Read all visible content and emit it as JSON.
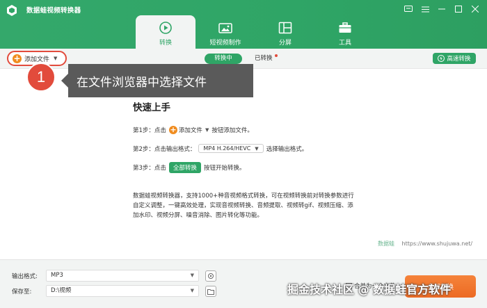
{
  "app": {
    "title": "数据蛙视频转换器"
  },
  "tabs": [
    {
      "label": "转换",
      "icon": "convert-icon",
      "active": true
    },
    {
      "label": "短视频制作",
      "icon": "short-video-icon",
      "active": false
    },
    {
      "label": "分屏",
      "icon": "split-screen-icon",
      "active": false
    },
    {
      "label": "工具",
      "icon": "toolbox-icon",
      "active": false
    }
  ],
  "toolbar": {
    "add_file": "添加文件",
    "converting": "转换中",
    "converted": "已转换",
    "fast_convert": "高速转换"
  },
  "callout": {
    "number": "1",
    "text": "在文件浏览器中选择文件"
  },
  "quickstart": {
    "title": "快速上手",
    "step1_prefix": "第1步：点击",
    "step1_button": "添加文件",
    "step1_suffix": "按钮添加文件。",
    "step2_prefix": "第2步：点击输出格式：",
    "step2_format": "MP4 H.264/HEVC",
    "step2_suffix": "选择输出格式。",
    "step3_prefix": "第3步：点击",
    "step3_button": "全部转换",
    "step3_suffix": "按钮开始转换。",
    "description": "数据蛙视频转换器，支持1000+种音视频格式转换，可在视频转换前对转换参数进行自定义调整，一键高效处理，实现音视频转换、音频提取、视频转gif、视频压缩、添加水印、视频分屏、噪音消除、图片转化等功能。",
    "brand": "数据蛙",
    "url": "https://www.shujuwa.net/"
  },
  "bottom": {
    "format_label": "输出格式:",
    "format_value": "MP3",
    "save_label": "保存至:",
    "save_value": "D:\\视频",
    "merge_label": "合并为一个文件",
    "convert_all": "全部转换"
  },
  "watermark": "掘金技术社区 @ 数据蛙官方软件",
  "colors": {
    "accent": "#2fa566",
    "orange": "#ec6a23",
    "callout_red": "#e24b3c"
  }
}
